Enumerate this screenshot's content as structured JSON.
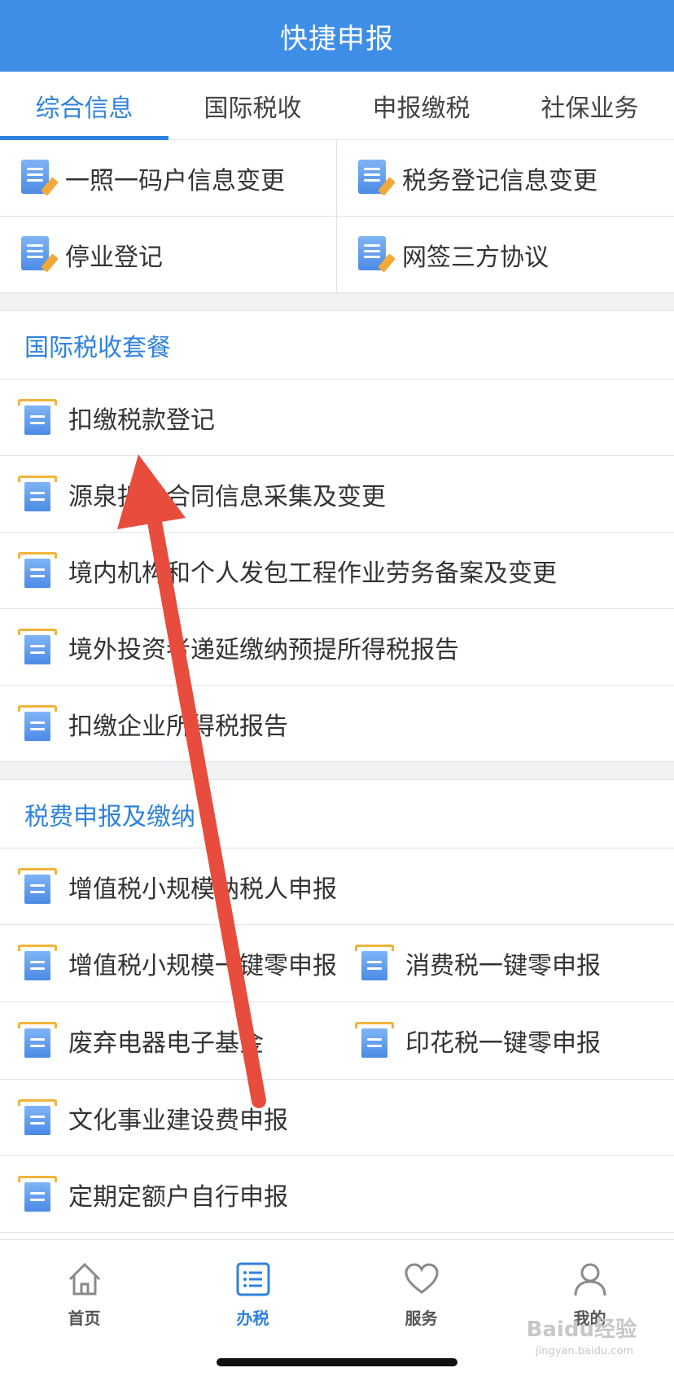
{
  "header": {
    "title": "快捷申报"
  },
  "tabs": [
    {
      "label": "综合信息",
      "active": true
    },
    {
      "label": "国际税收",
      "active": false
    },
    {
      "label": "申报缴税",
      "active": false
    },
    {
      "label": "社保业务",
      "active": false
    }
  ],
  "top_grid": [
    {
      "label": "一照一码户信息变更",
      "icon": "document-edit-icon"
    },
    {
      "label": "税务登记信息变更",
      "icon": "document-edit-icon"
    },
    {
      "label": "停业登记",
      "icon": "document-edit-icon"
    },
    {
      "label": "网签三方协议",
      "icon": "document-edit-icon"
    }
  ],
  "section_intl": {
    "title": "国际税收套餐",
    "items": [
      "扣缴税款登记",
      "源泉扣缴合同信息采集及变更",
      "境内机构和个人发包工程作业劳务备案及变更",
      "境外投资者递延缴纳预提所得税报告",
      "扣缴企业所得税报告"
    ]
  },
  "section_tax": {
    "title": "税费申报及缴纳",
    "row1": "增值税小规模纳税人申报",
    "row2_left": "增值税小规模一键零申报",
    "row2_right": "消费税一键零申报",
    "row3_left": "废弃电器电子基金",
    "row3_right": "印花税一键零申报",
    "row4": "文化事业建设费申报",
    "row5": "定期定额户自行申报"
  },
  "bottom_nav": [
    {
      "label": "首页",
      "icon": "home-icon",
      "active": false
    },
    {
      "label": "办税",
      "icon": "list-icon",
      "active": true
    },
    {
      "label": "服务",
      "icon": "heart-icon",
      "active": false
    },
    {
      "label": "我的",
      "icon": "user-icon",
      "active": false
    }
  ],
  "watermark": {
    "text": "Baidu经验",
    "sub": "jingyan.baidu.com"
  },
  "colors": {
    "header_bg": "#3e8ee8",
    "accent": "#2f82de",
    "arrow": "#e84c3d"
  }
}
